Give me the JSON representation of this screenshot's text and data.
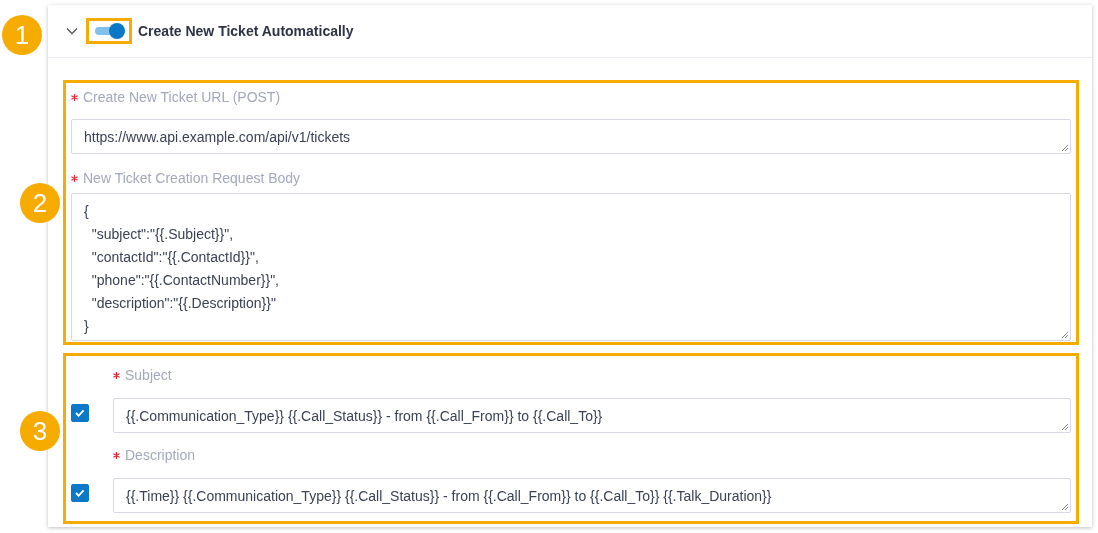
{
  "panel": {
    "expanded": true,
    "callout": "1",
    "toggle": {
      "on": true,
      "highlighted": true
    },
    "title": "Create New Ticket Automatically"
  },
  "request_group": {
    "callout": "2",
    "highlighted": true,
    "fields": [
      {
        "kind": "input",
        "required": true,
        "label": "Create New Ticket URL (POST)",
        "value": "https://www.api.example.com/api/v1/tickets"
      },
      {
        "kind": "textarea",
        "required": true,
        "label": "New Ticket Creation Request Body",
        "value": "{\n  \"subject\":\"{{.Subject}}\",\n  \"contactId\":\"{{.ContactId}}\",\n  \"phone\":\"{{.ContactNumber}}\",\n  \"description\":\"{{.Description}}\"\n}"
      }
    ]
  },
  "mapping_group": {
    "callout": "3",
    "highlighted": true,
    "fields": [
      {
        "required": true,
        "label": "Subject",
        "checked": true,
        "value": "{{.Communication_Type}} {{.Call_Status}} - from {{.Call_From}} to {{.Call_To}}"
      },
      {
        "required": true,
        "label": "Description",
        "checked": true,
        "value": "{{.Time}} {{.Communication_Type}} {{.Call_Status}} - from {{.Call_From}} to {{.Call_To}} {{.Talk_Duration}}"
      }
    ]
  }
}
